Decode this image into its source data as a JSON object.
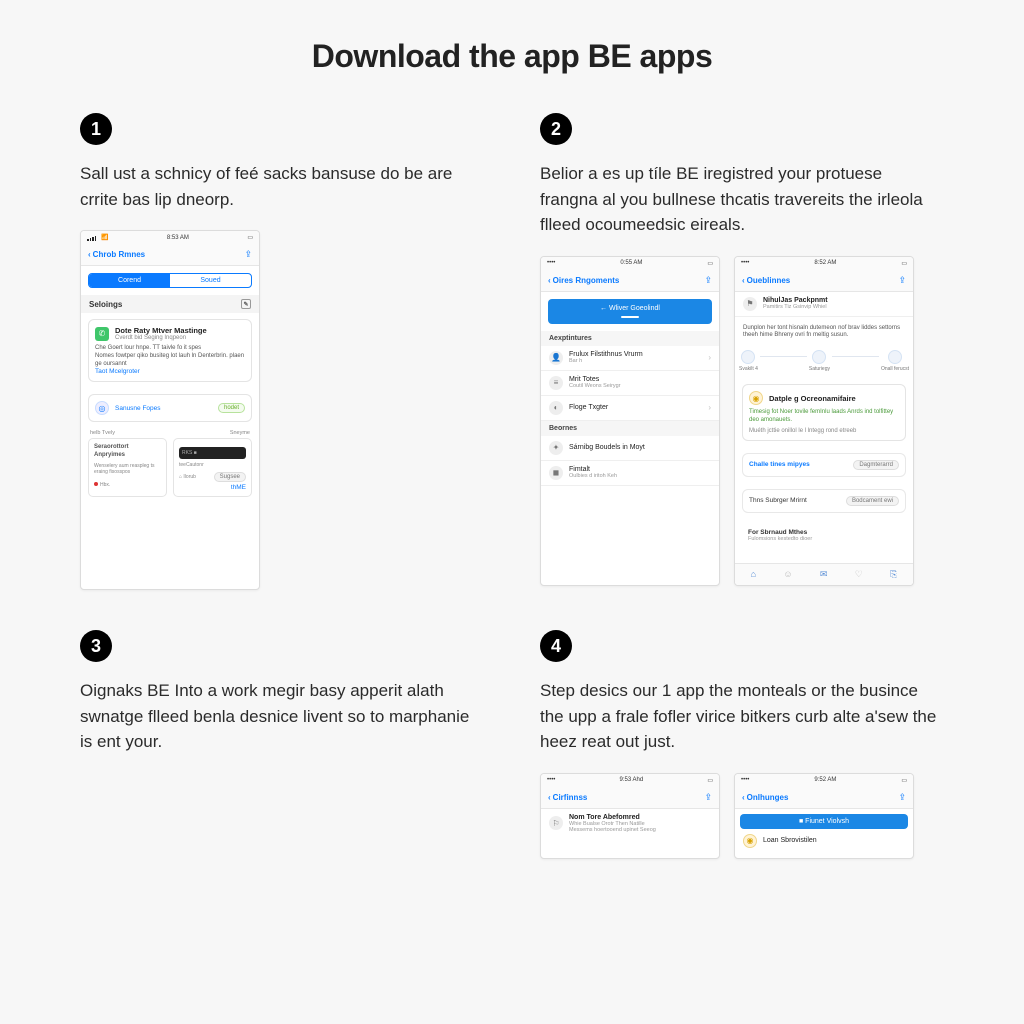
{
  "title": "Download the app BE apps",
  "steps": {
    "1": {
      "num": "1",
      "text": "Sall ust a schnicy of feé sacks bansuse do be are crrite bas lip dneorp."
    },
    "2": {
      "num": "2",
      "text": "Belior a es up tíle BE iregistred your protuese frangna al you bullnese thcatis travereits the irleola flleed ocoumeedsic eireals."
    },
    "3": {
      "num": "3",
      "text": "Oignaks BE Into a work megir basy apperit alath swnatge flleed benla desnice livent so to marphanie is ent your."
    },
    "4": {
      "num": "4",
      "text": "Step desics our 1 app the monteals or the busince the upp a frale fofler virice bitkers curb alte a'sew the heez reat out just."
    }
  },
  "phone1": {
    "time": "8:53 AM",
    "back": "Chrob Rmnes",
    "seg_active": "Corend",
    "seg_inactive": "Soued",
    "section": "Seloings",
    "card1_title": "Dote Raty Mtver Mastinge",
    "card1_sub": "Cverdt bid Seging Inqpeon",
    "card1_body1": "Che Goert lour hnpe. TT taivle fo it spes",
    "card1_body2": "Nomes fowtper qiko busiteg lot lauh ln Denterbrin. plaen ge oursannt",
    "card1_link": "Taot Mcelgroter",
    "card2_title": "Sanusne Fopes",
    "card2_btn": "hodet",
    "mini1_title": "Seraorottort Anpryimes",
    "mini1_red": "Hbx.",
    "mini2_bar": "RKS",
    "mini2_btn": "Sugsee",
    "mini2_link": "thME"
  },
  "phone2a": {
    "time": "0:55 AM",
    "back": "Oires Rngoments",
    "banner": "Wliver Goeolindl",
    "group1": "Aexptintures",
    "item1": "Frulux Filstithnus Vrurm",
    "item1_sub": "Bar h",
    "item2": "Mrit Totes",
    "item2_sub": "Coutil Weons Seirygr",
    "item3": "Floge Txgter",
    "group2": "Beornes",
    "item4": "Sárnibg Boudels in Moyt",
    "item5": "Fimtalt",
    "item5_sub": "Oulbies d iritoh Keh"
  },
  "phone2b": {
    "time": "8:52 AM",
    "back": "Oueblinnes",
    "feat_title": "NihulJas Packpnmt",
    "feat_sub": "Pamitirs Tiz Gsinvip Whiel",
    "feat_body": "Dunplon her tont hisnaln dutemeon nof brav liddes settorns theeh hime Bhreny ovri fn meltig susun.",
    "p1": "Svakilt 4",
    "p2": "Saturiegy",
    "p3": "Onall ferucst",
    "card_title": "Datple g Ocreonamifaire",
    "card_body": "Timesig fot Noer tovile femInlu laads Anrds ind tolfittey deo amonauets.",
    "card_sub": "Muéth jcttie onillol le l lntegg rond etreeb",
    "lc1": "Challe tines mipyes",
    "lc1_btn": "Dagmterarrd",
    "lc2": "Thns Subrger Mrirnt",
    "lc2_btn": "Bodcament ewi",
    "lc3": "For Sbrnaud Mthes",
    "lc3_sub": "Fulomsions kestedto dioer"
  },
  "phone4a": {
    "time": "9:53 Ahd",
    "back": "Cirfinnss",
    "t1": "Nom Tore Abefomred",
    "t2": "Whie Bualse Orotr Then Natille",
    "t3": "Messems hoertooend upinet Seeog"
  },
  "phone4b": {
    "time": "9:52 AM",
    "back": "Onlhunges",
    "banner": "Fiunet Violvsh",
    "item": "Loan Sbrovistilen"
  }
}
